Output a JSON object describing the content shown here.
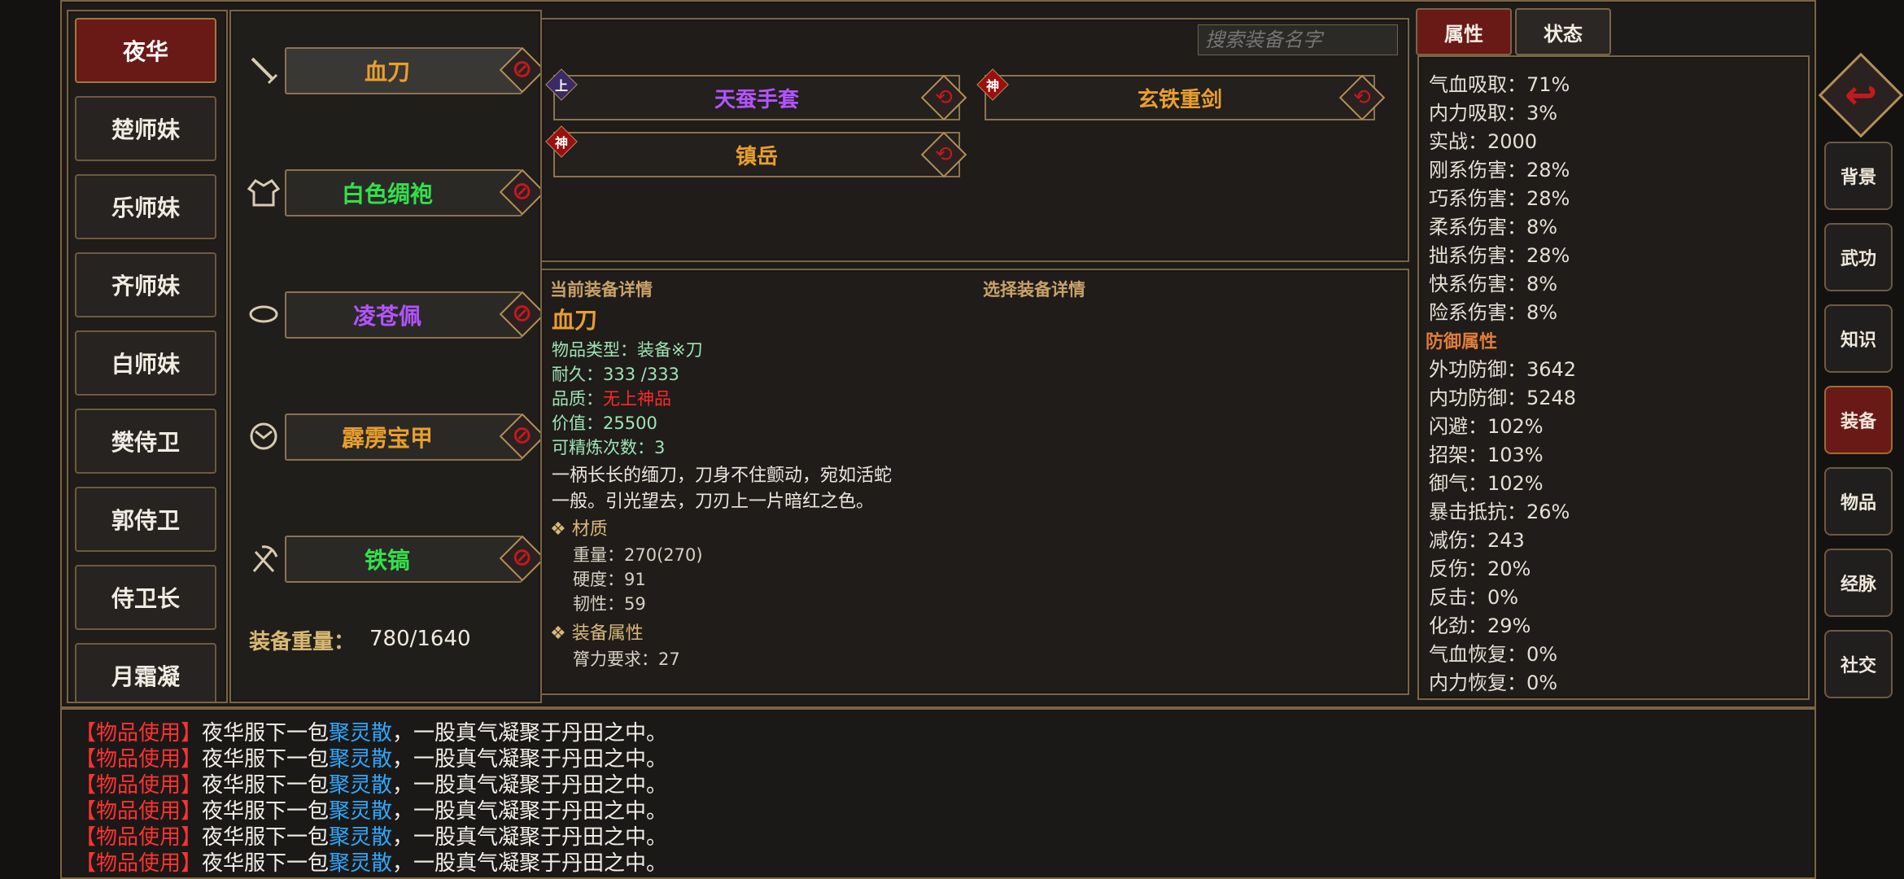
{
  "roster": {
    "items": [
      "夜华",
      "楚师妹",
      "乐师妹",
      "齐师妹",
      "白师妹",
      "樊侍卫",
      "郭侍卫",
      "侍卫长",
      "月霜凝"
    ],
    "active_index": 0
  },
  "slots": [
    {
      "icon": "sword-icon",
      "name": "血刀",
      "color": "#e99f2e",
      "clear": "⊘"
    },
    {
      "icon": "robe-icon",
      "name": "白色绸袍",
      "color": "#33e04a",
      "clear": "⊘"
    },
    {
      "icon": "ring-icon",
      "name": "凌苍佩",
      "color": "#b354ff",
      "clear": "⊘"
    },
    {
      "icon": "armor-icon",
      "name": "霹雳宝甲",
      "color": "#e99f2e",
      "clear": "⊘"
    },
    {
      "icon": "pickaxe-icon",
      "name": "铁镐",
      "color": "#33e04a",
      "clear": "⊘"
    }
  ],
  "equip_weight": {
    "label": "装备重量：",
    "value": "780/1640"
  },
  "search": {
    "placeholder": "搜索装备名字"
  },
  "list_items": [
    {
      "name": "天蚕手套",
      "color": "#b354ff",
      "tag": "上",
      "tag_bg": "#3a2a66"
    },
    {
      "name": "玄铁重剑",
      "color": "#e99f2e",
      "tag": "神",
      "tag_bg": "#9a1010"
    },
    {
      "name": "镇岳",
      "color": "#e99f2e",
      "tag": "神",
      "tag_bg": "#9a1010"
    }
  ],
  "swap_icon": "⟲",
  "detail": {
    "current_header": "当前装备详情",
    "select_header": "选择装备详情",
    "name": "血刀",
    "type_label": "物品类型：",
    "type_value": "装备※刀",
    "durability_label": "耐久：",
    "durability_value": "333 /333",
    "quality_label": "品质：",
    "quality_value": "无上神品",
    "value_label": "价值：",
    "value_value": "25500",
    "refine_label": "可精炼次数：",
    "refine_value": "3",
    "desc_line1": "一柄长长的缅刀，刀身不住颤动，宛如活蛇",
    "desc_line2": "一般。引光望去，刀刃上一片暗红之色。",
    "material_header": "❖ 材质",
    "weight": "重量：270(270)",
    "hardness": "硬度：91",
    "toughness": "韧性：59",
    "attr_header": "❖ 装备属性",
    "str_req": "膂力要求：27"
  },
  "tabs": {
    "attr": "属性",
    "status": "状态"
  },
  "stats": {
    "items_a": [
      "气血吸取：71%",
      "内力吸取：3%",
      "实战：2000",
      "刚系伤害：28%",
      "巧系伤害：28%",
      "柔系伤害：8%",
      "拙系伤害：28%",
      "快系伤害：8%",
      "险系伤害：8%"
    ],
    "defense_header": "防御属性",
    "items_b": [
      "外功防御：3642",
      "内功防御：5248",
      "闪避：102%",
      "招架：103%",
      "御气：102%",
      "暴击抵抗：26%",
      "减伤：243",
      "反伤：20%",
      "反击：0%",
      "化劲：29%",
      "气血恢复：0%",
      "内力恢复：0%"
    ]
  },
  "nav": {
    "back": "↩",
    "items": [
      "背景",
      "武功",
      "知识",
      "装备",
      "物品",
      "经脉",
      "社交"
    ],
    "active_index": 3
  },
  "log": {
    "lines": [
      {
        "tag": "【物品使用】",
        "pre": "夜华服下一包",
        "item": "聚灵散",
        "post": "，一股真气凝聚于丹田之中。"
      },
      {
        "tag": "【物品使用】",
        "pre": "夜华服下一包",
        "item": "聚灵散",
        "post": "，一股真气凝聚于丹田之中。"
      },
      {
        "tag": "【物品使用】",
        "pre": "夜华服下一包",
        "item": "聚灵散",
        "post": "，一股真气凝聚于丹田之中。"
      },
      {
        "tag": "【物品使用】",
        "pre": "夜华服下一包",
        "item": "聚灵散",
        "post": "，一股真气凝聚于丹田之中。"
      },
      {
        "tag": "【物品使用】",
        "pre": "夜华服下一包",
        "item": "聚灵散",
        "post": "，一股真气凝聚于丹田之中。"
      },
      {
        "tag": "【物品使用】",
        "pre": "夜华服下一包",
        "item": "聚灵散",
        "post": "，一股真气凝聚于丹田之中。"
      }
    ]
  }
}
